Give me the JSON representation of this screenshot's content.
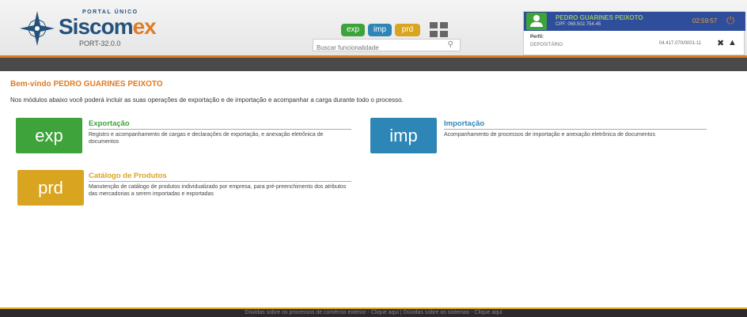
{
  "header": {
    "portal_label": "PORTAL ÚNICO",
    "brand_part1": "Siscom",
    "brand_part2": "ex",
    "version": "PORT-32.0.0",
    "module_chips": [
      "exp",
      "imp",
      "prd"
    ],
    "search_placeholder": "Buscar funcionalidade"
  },
  "user": {
    "name": "PEDRO GUARINES PEIXOTO",
    "cpf": "CPF: 069.502.754-45",
    "timer": "02:59:57",
    "perfil_label": "Perfil:",
    "perfil_value": "DEPOSITÁRIO",
    "cnpj": "04.417.070/0001-11"
  },
  "main": {
    "welcome": "Bem-vindo PEDRO GUARINES PEIXOTO",
    "intro": "Nos módulos abaixo você poderá incluir as suas operações de exportação e de importação e acompanhar a carga durante todo o processo.",
    "modules": [
      {
        "tile": "exp",
        "title": "Exportação",
        "description": "Registro e acompanhamento de cargas e declarações de exportação, e anexação eletrônica de documentos"
      },
      {
        "tile": "imp",
        "title": "Importação",
        "description": "Acompanhamento de processos de importação e anexação eletrônica de documentos"
      },
      {
        "tile": "prd",
        "title": "Catálogo de Produtos",
        "description": "Manutenção de catálogo de produtos individualizado por empresa, para pré-preenchimento dos atributos das mercadorias a serem importadas e exportadas"
      }
    ]
  },
  "footer": {
    "text": "Dúvidas sobre os processos de comércio exterior - Clique aqui | Dúvidas sobre os sistemas - Clique aqui"
  },
  "colors": {
    "exp": "#3da33a",
    "imp": "#2e86b7",
    "prd": "#d9a520",
    "accent_orange": "#e07b24",
    "user_bar": "#2e4d9a"
  }
}
